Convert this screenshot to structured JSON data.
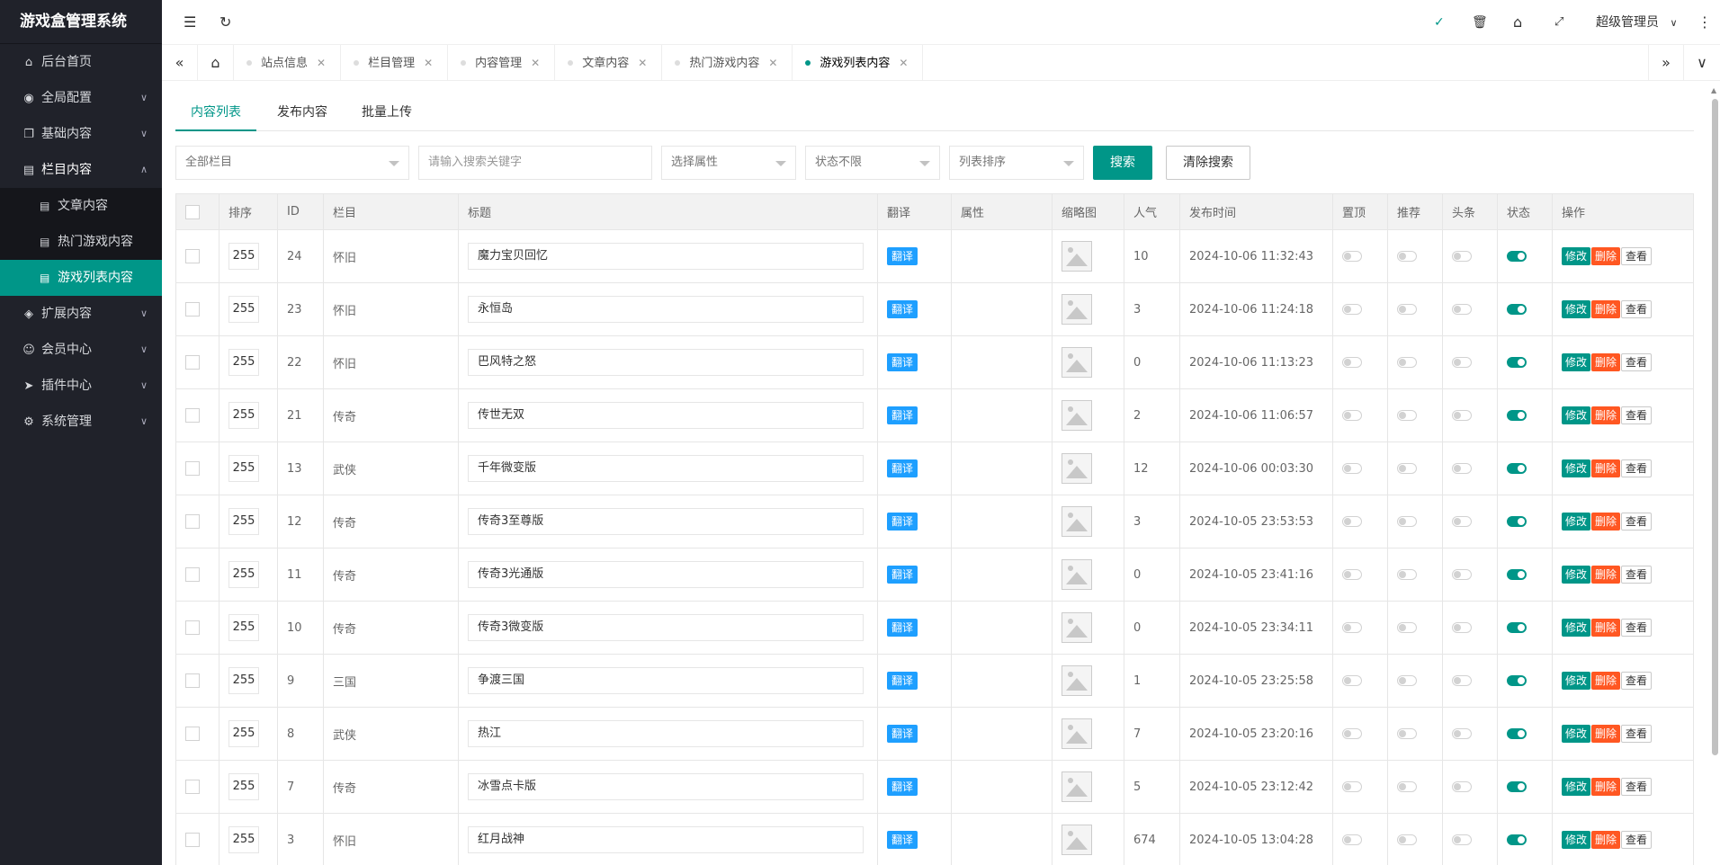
{
  "app": {
    "title": "游戏盒管理系统"
  },
  "sidebar": {
    "items": [
      {
        "label": "后台首页",
        "icon": "home-icon",
        "glyph": "⌂"
      },
      {
        "label": "全局配置",
        "icon": "globe-icon",
        "glyph": "◉"
      },
      {
        "label": "基础内容",
        "icon": "copy-icon",
        "glyph": "❐"
      },
      {
        "label": "栏目内容",
        "icon": "file-icon",
        "glyph": "▤"
      },
      {
        "label": "扩展内容",
        "icon": "cube-icon",
        "glyph": "◈"
      },
      {
        "label": "会员中心",
        "icon": "user-icon",
        "glyph": "☺"
      },
      {
        "label": "插件中心",
        "icon": "send-icon",
        "glyph": "➤"
      },
      {
        "label": "系统管理",
        "icon": "gears-icon",
        "glyph": "⚙"
      }
    ],
    "sub_items": [
      "文章内容",
      "热门游戏内容",
      "游戏列表内容"
    ]
  },
  "header": {
    "user": "超级管理员"
  },
  "tabs": [
    "站点信息",
    "栏目管理",
    "内容管理",
    "文章内容",
    "热门游戏内容",
    "游戏列表内容"
  ],
  "subtabs": [
    "内容列表",
    "发布内容",
    "批量上传"
  ],
  "filters": {
    "column": "全部栏目",
    "keyword_placeholder": "请输入搜索关键字",
    "attribute": "选择属性",
    "status": "状态不限",
    "sort": "列表排序",
    "search_btn": "搜索",
    "clear_btn": "清除搜索"
  },
  "table": {
    "headers": [
      "排序",
      "ID",
      "栏目",
      "标题",
      "翻译",
      "属性",
      "缩略图",
      "人气",
      "发布时间",
      "置顶",
      "推荐",
      "头条",
      "状态",
      "操作"
    ],
    "translate_label": "翻译",
    "ops": {
      "edit": "修改",
      "delete": "删除",
      "view": "查看"
    },
    "rows": [
      {
        "sort": "255",
        "id": "24",
        "column": "怀旧",
        "title": "魔力宝贝回忆",
        "views": "10",
        "time": "2024-10-06 11:32:43"
      },
      {
        "sort": "255",
        "id": "23",
        "column": "怀旧",
        "title": "永恒岛",
        "views": "3",
        "time": "2024-10-06 11:24:18"
      },
      {
        "sort": "255",
        "id": "22",
        "column": "怀旧",
        "title": "巴风特之怒",
        "views": "0",
        "time": "2024-10-06 11:13:23"
      },
      {
        "sort": "255",
        "id": "21",
        "column": "传奇",
        "title": "传世无双",
        "views": "2",
        "time": "2024-10-06 11:06:57"
      },
      {
        "sort": "255",
        "id": "13",
        "column": "武侠",
        "title": "千年微变版",
        "views": "12",
        "time": "2024-10-06 00:03:30"
      },
      {
        "sort": "255",
        "id": "12",
        "column": "传奇",
        "title": "传奇3至尊版",
        "views": "3",
        "time": "2024-10-05 23:53:53"
      },
      {
        "sort": "255",
        "id": "11",
        "column": "传奇",
        "title": "传奇3光通版",
        "views": "0",
        "time": "2024-10-05 23:41:16"
      },
      {
        "sort": "255",
        "id": "10",
        "column": "传奇",
        "title": "传奇3微变版",
        "views": "0",
        "time": "2024-10-05 23:34:11"
      },
      {
        "sort": "255",
        "id": "9",
        "column": "三国",
        "title": "争渡三国",
        "views": "1",
        "time": "2024-10-05 23:25:58"
      },
      {
        "sort": "255",
        "id": "8",
        "column": "武侠",
        "title": "热江",
        "views": "7",
        "time": "2024-10-05 23:20:16"
      },
      {
        "sort": "255",
        "id": "7",
        "column": "传奇",
        "title": "冰雪点卡版",
        "views": "5",
        "time": "2024-10-05 23:12:42"
      },
      {
        "sort": "255",
        "id": "3",
        "column": "怀旧",
        "title": "红月战神",
        "views": "674",
        "time": "2024-10-05 13:04:28"
      }
    ]
  },
  "colors": {
    "accent": "#009688",
    "danger": "#FF5722",
    "info": "#1E9FFF",
    "sidebar": "#20222A"
  }
}
